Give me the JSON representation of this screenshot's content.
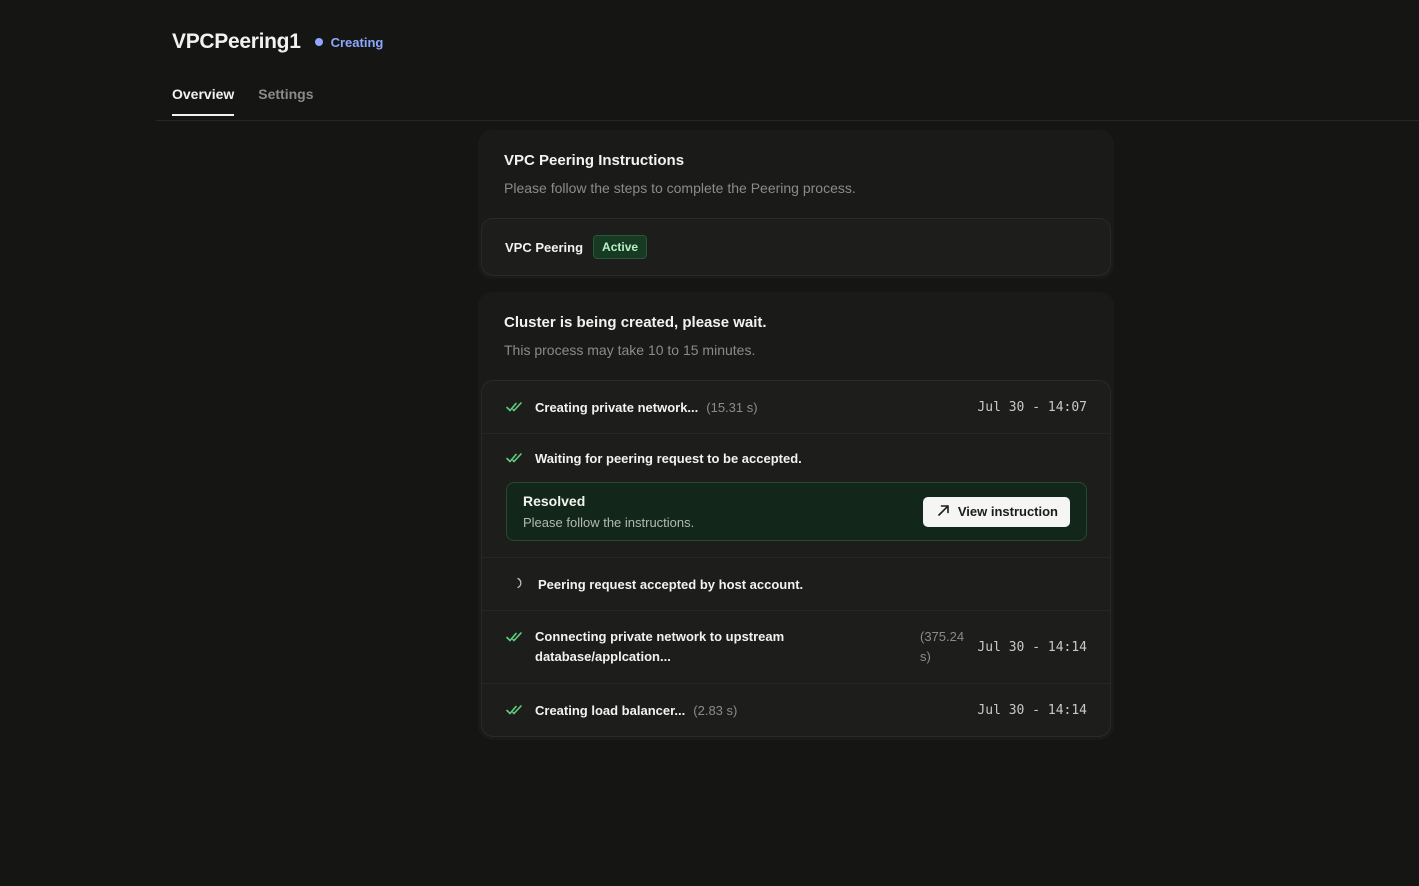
{
  "header": {
    "title": "VPCPeering1",
    "status": "Creating"
  },
  "tabs": [
    {
      "label": "Overview"
    },
    {
      "label": "Settings"
    }
  ],
  "instructions": {
    "title": "VPC Peering Instructions",
    "subtitle": "Please follow the steps to complete the Peering process.",
    "peering_label": "VPC Peering",
    "peering_status": "Active"
  },
  "cluster": {
    "title": "Cluster is being created, please wait.",
    "subtitle": "This process may take 10 to 15 minutes.",
    "steps": [
      {
        "text": "Creating private network...",
        "duration": "(15.31 s)",
        "time": "Jul 30 - 14:07"
      },
      {
        "text": "Waiting for peering request to be accepted."
      },
      {
        "text": "Peering request accepted by host account."
      },
      {
        "text": "Connecting private network to upstream database/applcation...",
        "duration": "(375.24 s)",
        "time": "Jul 30 - 14:14"
      },
      {
        "text": "Creating load balancer...",
        "duration": "(2.83 s)",
        "time": "Jul 30 - 14:14"
      }
    ],
    "resolved": {
      "title": "Resolved",
      "subtitle": "Please follow the instructions.",
      "button": "View instruction"
    }
  },
  "icons": {
    "check": "double-check-icon",
    "arrow": "arrow-up-right-icon",
    "spinner": "spinner-icon"
  },
  "colors": {
    "accent_blue": "#8fa8ff",
    "success_green": "#5fd07b"
  }
}
